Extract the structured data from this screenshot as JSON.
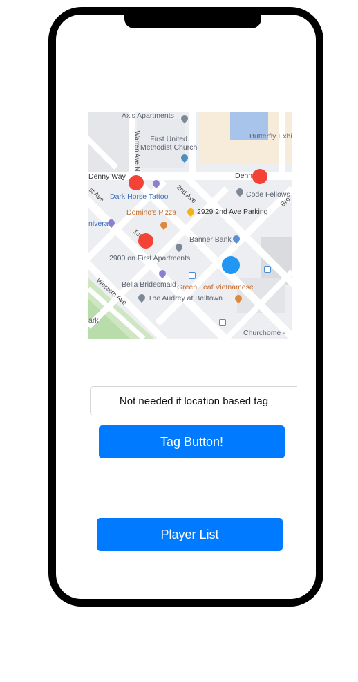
{
  "map": {
    "labels": {
      "axis_apartments": "Axis Apartments",
      "first_united": "First United\nMethodist Church",
      "butterfly": "Butterfly Exhi",
      "denny_way": "Denny Way",
      "denny_right": "Denn",
      "dark_horse": "Dark Horse Tattoo",
      "code_fellows": "Code Fellows",
      "second_ave": "2nd Ave",
      "dominos": "Domino's Pizza",
      "parking": "2929 2nd Ave Parking",
      "first_ave": "1st",
      "banner_bank": "Banner Bank",
      "first_apartments": "2900 on First Apartments",
      "bella": "Bella Bridesmaid",
      "green_leaf": "Green Leaf Vietnamese",
      "western_ave": "Western Ave",
      "audrey": "The Audrey at Belltown",
      "churchome": "Churchome -",
      "warren_ave": "Warren Ave N",
      "st_ave": "st Ave",
      "nivera": "nivera",
      "ark": "ark",
      "bro": "Bro"
    }
  },
  "form": {
    "tag_placeholder": "Not needed if location based tag",
    "tag_button": "Tag Button!",
    "player_list_button": "Player List"
  },
  "colors": {
    "accent": "#007bff",
    "player_marker": "#f44336",
    "self_marker": "#2196f3"
  }
}
